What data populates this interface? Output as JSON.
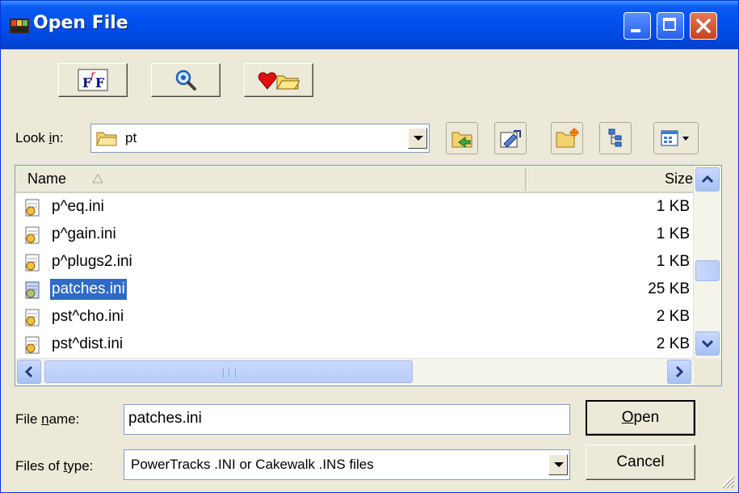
{
  "window": {
    "title": "Open File"
  },
  "toolbar": {
    "icons": [
      "font-icon",
      "search-icon",
      "favorites-icon"
    ]
  },
  "lookin": {
    "label_pre": "Look ",
    "label_accel": "i",
    "label_post": "n:",
    "value": "pt",
    "icon": "folder-icon"
  },
  "navbuttons": [
    "back-icon",
    "up-folder-icon",
    "new-folder-icon",
    "tree-view-icon",
    "view-menu-icon"
  ],
  "list": {
    "headers": {
      "name": "Name",
      "size": "Size"
    },
    "rows": [
      {
        "name": "p^eq.ini",
        "size": "1 KB",
        "selected": false
      },
      {
        "name": "p^gain.ini",
        "size": "1 KB",
        "selected": false
      },
      {
        "name": "p^plugs2.ini",
        "size": "1 KB",
        "selected": false
      },
      {
        "name": "patches.ini",
        "size": "25 KB",
        "selected": true
      },
      {
        "name": "pst^cho.ini",
        "size": "2 KB",
        "selected": false
      },
      {
        "name": "pst^dist.ini",
        "size": "2 KB",
        "selected": false
      }
    ]
  },
  "filename": {
    "label_pre": "File ",
    "label_accel": "n",
    "label_post": "ame:",
    "value": "patches.ini"
  },
  "filetype": {
    "label_pre": "Files of ",
    "label_accel": "t",
    "label_post": "ype:",
    "value": "PowerTracks .INI or Cakewalk .INS files"
  },
  "buttons": {
    "open_accel": "O",
    "open_rest": "pen",
    "cancel": "Cancel"
  },
  "colors": {
    "titlebar": "#0050EE",
    "selection": "#316AC5",
    "face": "#ECE9D8"
  }
}
